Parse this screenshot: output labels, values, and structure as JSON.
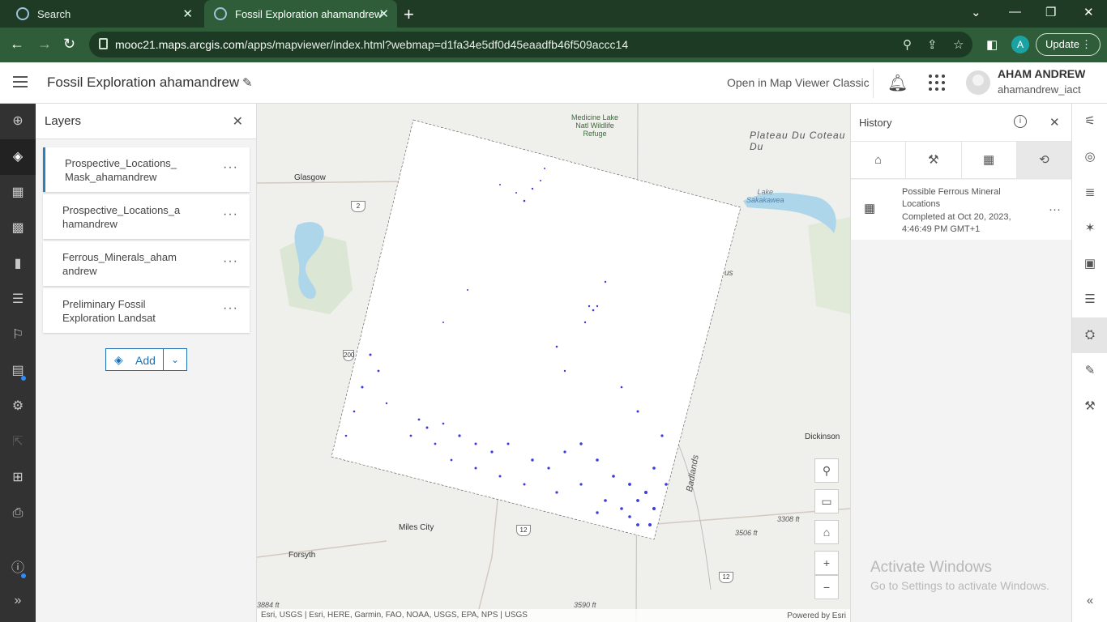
{
  "browser": {
    "tabs": [
      {
        "title": "Search",
        "active": false
      },
      {
        "title": "Fossil Exploration ahamandrew",
        "active": true
      }
    ],
    "url_host": "mooc21.maps.arcgis.com",
    "url_path": "/apps/mapviewer/index.html?webmap=d1fa34e5df0d45eaadfb46f509accc14",
    "profile_initial": "A",
    "update_label": "Update"
  },
  "header": {
    "map_title": "Fossil Exploration ahamandrew",
    "open_classic": "Open in Map Viewer Classic",
    "user_name": "AHAM ANDREW",
    "user_login": "ahamandrew_iact"
  },
  "layers_panel": {
    "title": "Layers",
    "layers": [
      {
        "name": "Prospective_Locations_\nMask_ahamandrew"
      },
      {
        "name": "Prospective_Locations_a\nhamandrew"
      },
      {
        "name": "Ferrous_Minerals_aham\nandrew"
      },
      {
        "name": "Preliminary Fossil\nExploration Landsat"
      }
    ],
    "add_label": "Add"
  },
  "map": {
    "labels": {
      "refuge": "Medicine Lake\nNatl Wildlife\nRefuge",
      "plateau": "Plateau Du Coteau Du",
      "glasgow": "Glasgow",
      "lake": "Lake\nSakakawea",
      "dickinson": "Dickinson",
      "badlands": "Badlands",
      "miles_city": "Miles City",
      "forsyth": "Forsyth",
      "elev1": "3308 ft",
      "elev2": "3506 ft",
      "elev3": "3590 ft",
      "elev4": "3884 ft",
      "hwy2": "2",
      "hwy12a": "12",
      "hwy12b": "12",
      "hwy200": "200",
      "frag_us": "us"
    },
    "attribution": "Esri, USGS | Esri, HERE, Garmin, FAO, NOAA, USGS, EPA, NPS | USGS",
    "powered_by": "Powered by Esri"
  },
  "history_panel": {
    "title": "History",
    "item_title": "Possible Ferrous Mineral Locations",
    "item_status": "Completed at Oct 20, 2023, 4:46:49 PM GMT+1"
  },
  "watermark": {
    "line1": "Activate Windows",
    "line2": "Go to Settings to activate Windows."
  }
}
